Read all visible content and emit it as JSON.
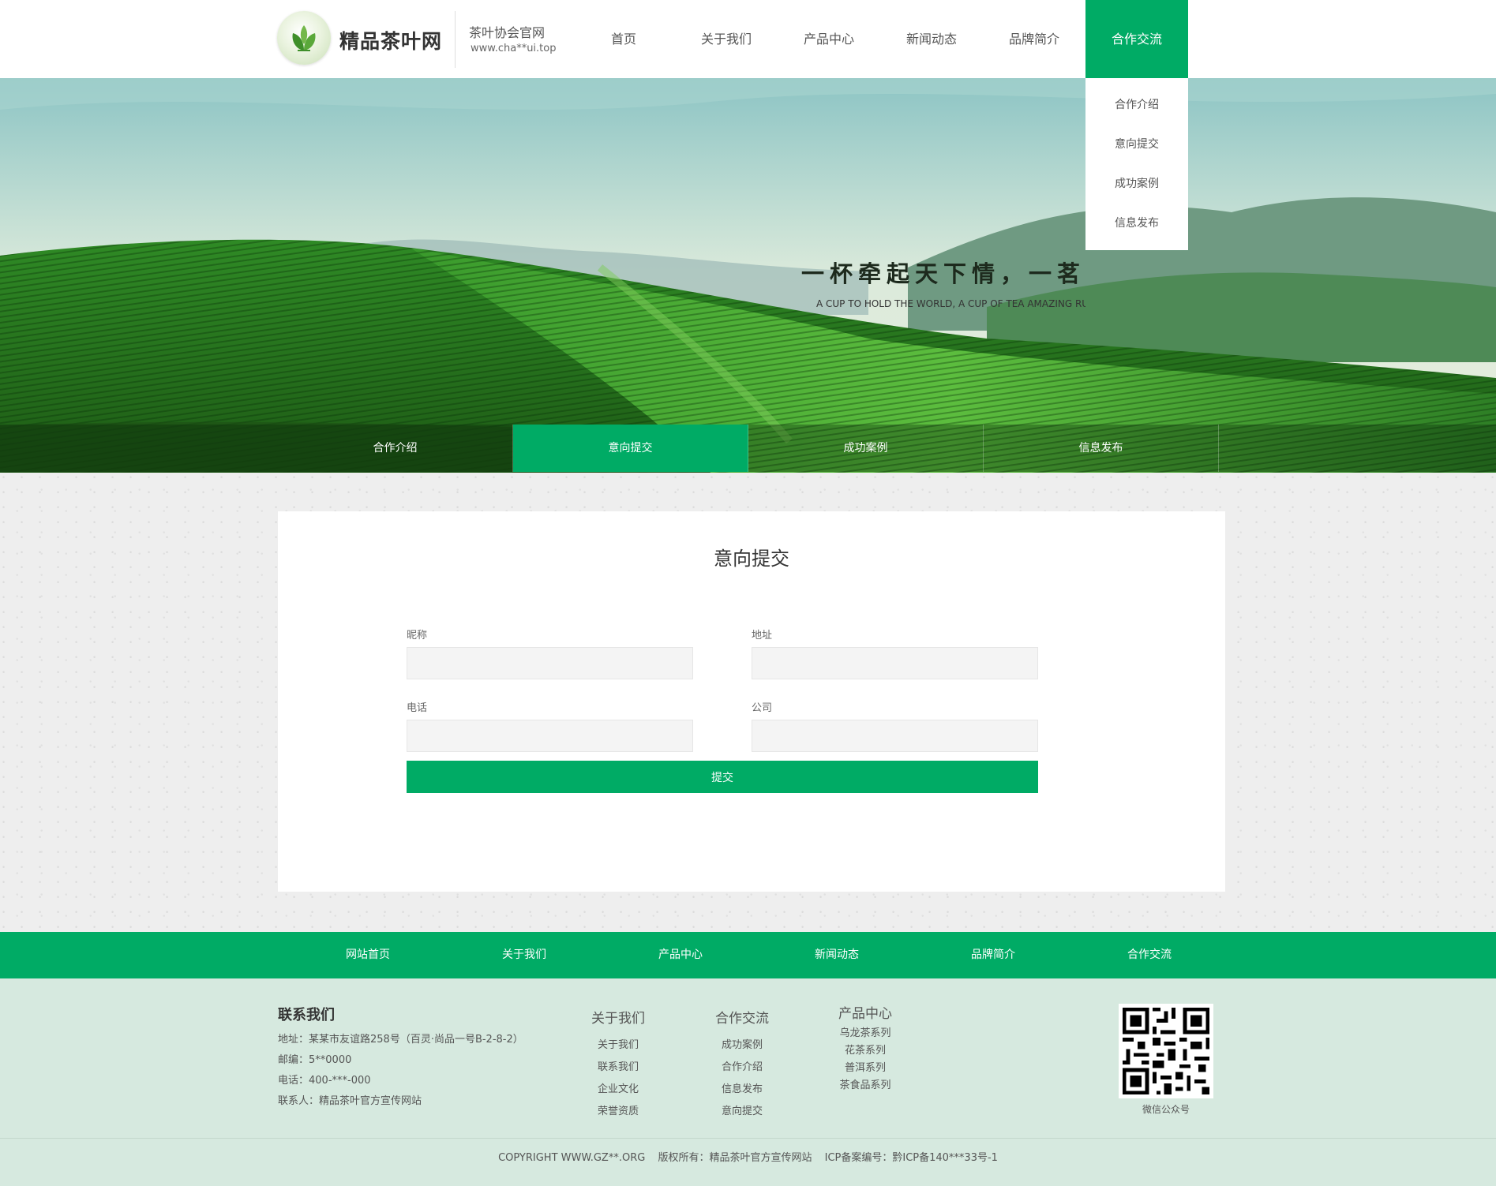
{
  "header": {
    "logo_title": "精品茶叶网",
    "logo_subtitle": "茶叶协会官网",
    "logo_url": "www.cha**ui.top",
    "nav": [
      "首页",
      "关于我们",
      "产品中心",
      "新闻动态",
      "品牌简介",
      "合作交流"
    ],
    "active_nav": "合作交流",
    "dropdown": [
      "合作介绍",
      "意向提交",
      "成功案例",
      "信息发布"
    ]
  },
  "banner": {
    "slogan": "一杯牵起天下情，一茗惊人",
    "slogan_en": "A CUP TO HOLD THE WORLD, A CUP OF TEA AMAZING RUI",
    "subnav": [
      "合作介绍",
      "意向提交",
      "成功案例",
      "信息发布"
    ],
    "active_subnav": "意向提交"
  },
  "form": {
    "title": "意向提交",
    "fields": {
      "nickname": {
        "label": "昵称",
        "value": ""
      },
      "address": {
        "label": "地址",
        "value": ""
      },
      "phone": {
        "label": "电话",
        "value": ""
      },
      "company": {
        "label": "公司",
        "value": ""
      }
    },
    "submit_label": "提交"
  },
  "footer_nav": [
    "网站首页",
    "关于我们",
    "产品中心",
    "新闻动态",
    "品牌简介",
    "合作交流"
  ],
  "footer": {
    "contact": {
      "title": "联系我们",
      "address": "地址：某某市友谊路258号（百灵·尚品一号B-2-8-2）",
      "postcode": "邮编：5**0000",
      "phone": "电话：400-***-000",
      "contact_person": "联系人：精品茶叶官方宣传网站"
    },
    "columns": [
      {
        "title": "关于我们",
        "links": [
          "关于我们",
          "联系我们",
          "企业文化",
          "荣誉资质"
        ]
      },
      {
        "title": "合作交流",
        "links": [
          "成功案例",
          "合作介绍",
          "信息发布",
          "意向提交"
        ]
      },
      {
        "title": "产品中心",
        "links": [
          "乌龙茶系列",
          "花茶系列",
          "普洱系列",
          "茶食品系列"
        ]
      }
    ],
    "qr_caption": "微信公众号"
  },
  "copyright": {
    "site": "COPYRIGHT WWW.GZ**.ORG",
    "owner": "版权所有：精品茶叶官方宣传网站",
    "icp": "ICP备案编号：黔ICP备140***33号-1"
  },
  "colors": {
    "accent": "#00ab65",
    "footer_bg": "#d6e9df"
  }
}
